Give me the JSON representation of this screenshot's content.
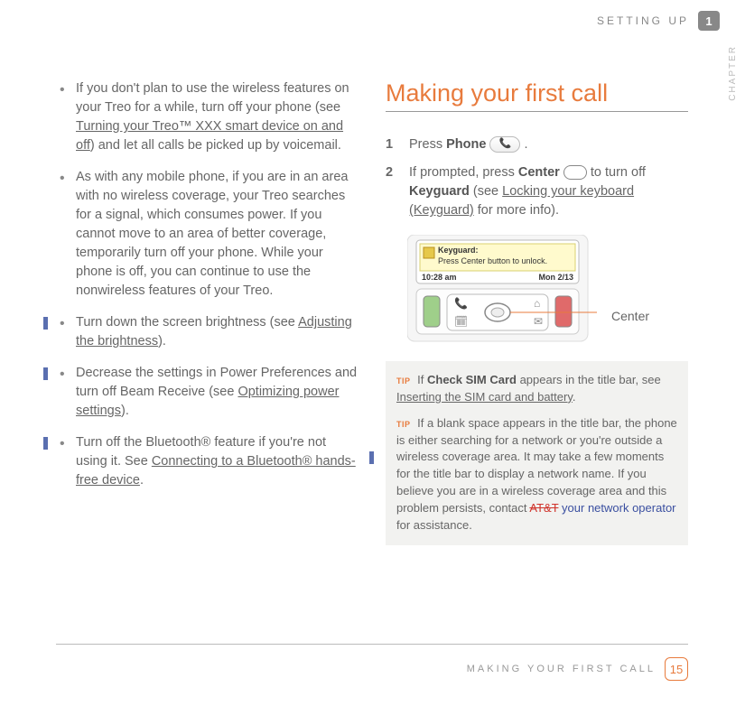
{
  "header": {
    "section": "SETTING UP",
    "chapter_num": "1",
    "vertical_label": "CHAPTER"
  },
  "left": {
    "bullets": [
      {
        "frags": [
          {
            "t": "If you don't plan to use the wireless features on your Treo for a while, turn off your phone (see "
          },
          {
            "t": "Turning your Treo™ XXX smart device on and off",
            "link": true
          },
          {
            "t": ") and let all calls be picked up by voicemail."
          }
        ]
      },
      {
        "frags": [
          {
            "t": "As with any mobile phone, if you are in an area with no wireless coverage, your Treo searches for a signal, which consumes power. If you cannot move to an area of better coverage, temporarily turn off your phone. While your phone is off, you can continue to use the nonwireless features of your Treo."
          }
        ]
      },
      {
        "chg": true,
        "frags": [
          {
            "t": "Turn down the screen brightness (see "
          },
          {
            "t": "Adjusting the brightness",
            "link": true
          },
          {
            "t": ")."
          }
        ]
      },
      {
        "chg": true,
        "frags": [
          {
            "t": "Decrease the settings in Power Preferences and turn off Beam Receive (see "
          },
          {
            "t": "Optimizing power settings",
            "link": true
          },
          {
            "t": ")."
          }
        ]
      },
      {
        "chg": true,
        "frags": [
          {
            "t": "Turn off the Bluetooth® feature if you're not using it. See "
          },
          {
            "t": "Connecting to a Bluetooth® hands-free device",
            "link": true
          },
          {
            "t": "."
          }
        ]
      }
    ]
  },
  "right": {
    "title": "Making your first call",
    "steps": [
      {
        "num": "1",
        "pre": "Press ",
        "bold1": "Phone",
        "post1": " ",
        "icon": "phone",
        "end": " ."
      },
      {
        "num": "2",
        "pre": "If prompted, press ",
        "bold1": "Center",
        "post1": " ",
        "icon": "oval",
        "post2": " to turn off ",
        "bold2": "Keyguard",
        "post3": " (see ",
        "link": "Locking your keyboard (Keyguard)",
        "end": " for more info)."
      }
    ],
    "device": {
      "lock_label": "Keyguard:",
      "lock_text": "Press Center button to unlock.",
      "time": "10:28 am",
      "date": "Mon 2/13",
      "annot": "Center"
    },
    "tips": {
      "tip_label": "TIP",
      "t1_a": "If ",
      "t1_bold": "Check SIM Card",
      "t1_b": " appears in the title bar, see ",
      "t1_link": "Inserting the SIM card and battery",
      "t1_c": ".",
      "t2_a": "If a blank space appears in the title bar, the phone is either searching for a network or you're outside a wireless coverage area. It may take a few moments for the title bar to display a network name. If you believe you are in a wireless coverage area and this problem persists, contact ",
      "t2_strike": "AT&T",
      "t2_ins": " your network operator",
      "t2_b": " for assistance."
    }
  },
  "footer": {
    "text": "MAKING YOUR FIRST CALL",
    "page": "15"
  }
}
